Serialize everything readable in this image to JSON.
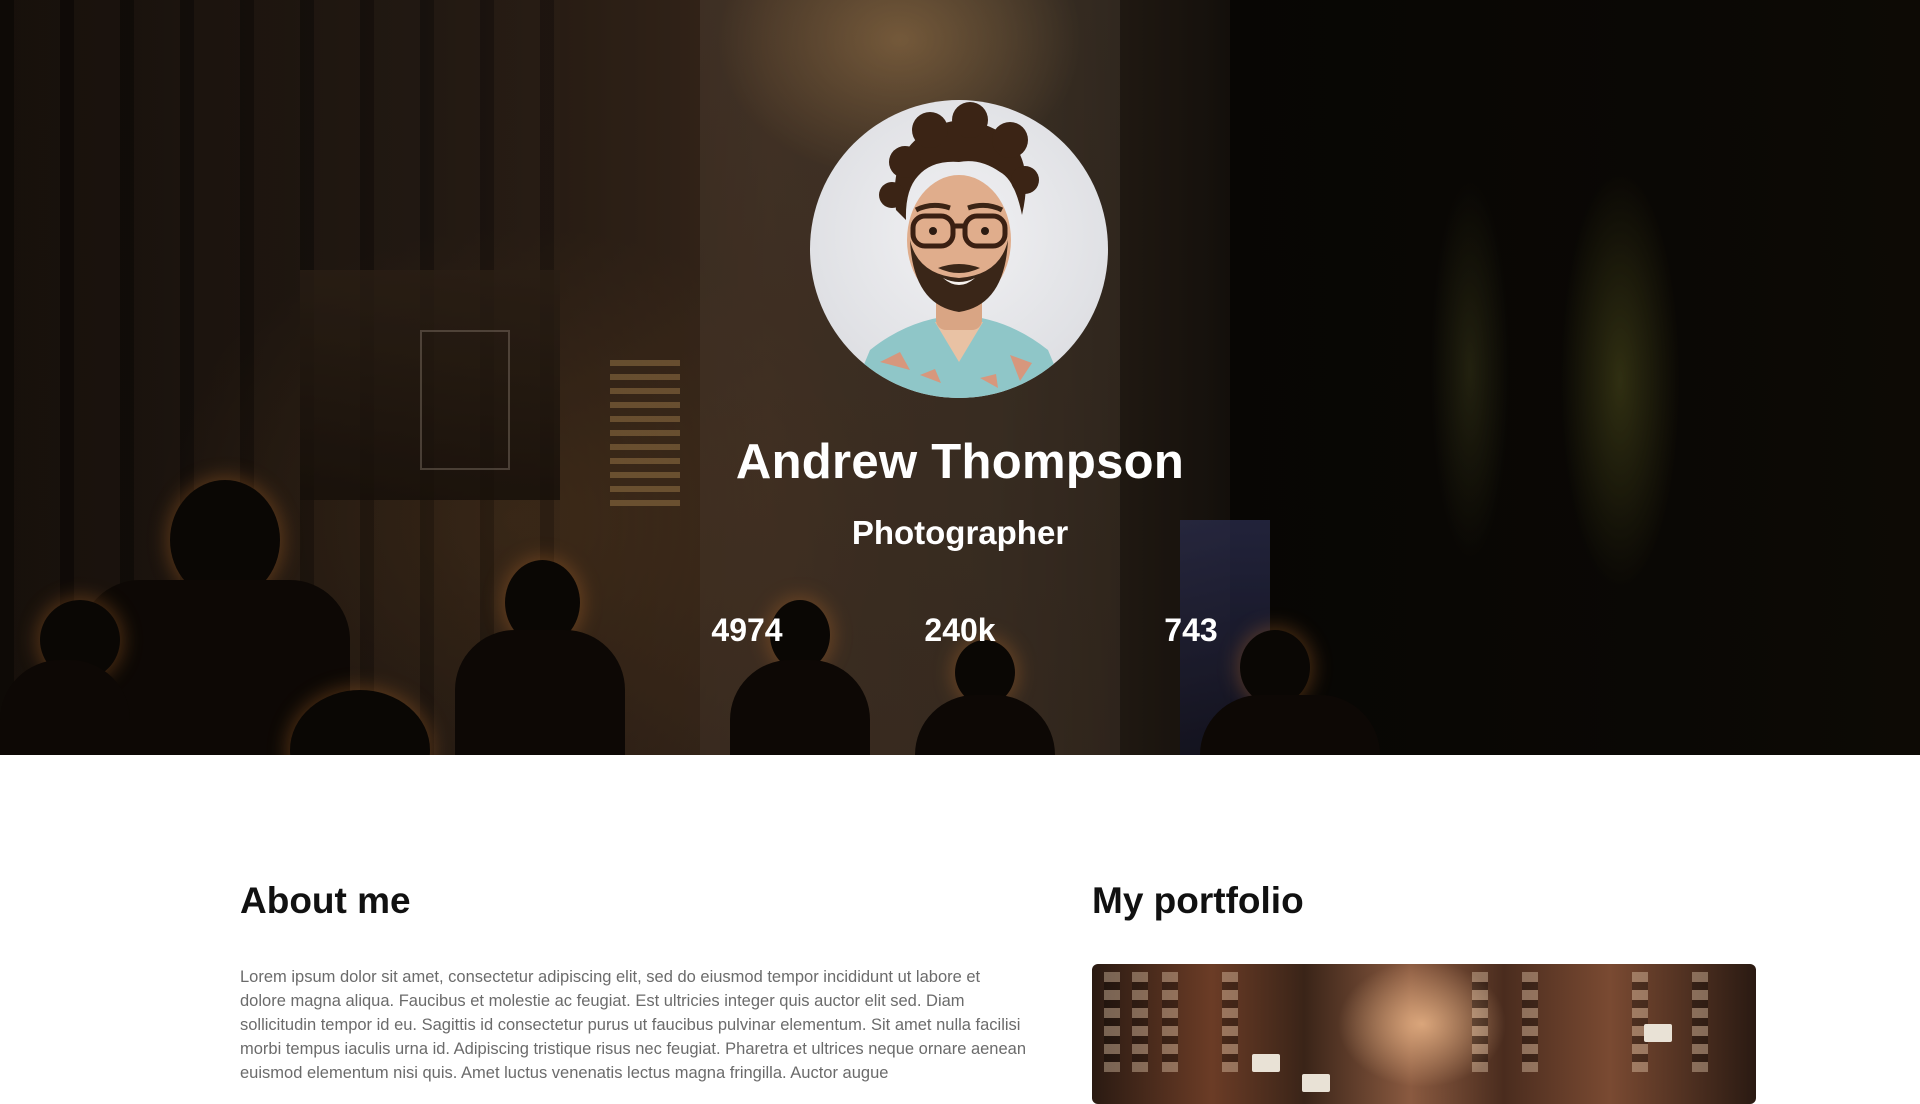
{
  "profile": {
    "name": "Andrew Thompson",
    "role": "Photographer",
    "stats": [
      "4974",
      "240k",
      "743"
    ]
  },
  "about": {
    "title": "About me",
    "text": "Lorem ipsum dolor sit amet, consectetur adipiscing elit, sed do eiusmod tempor incididunt ut labore et dolore magna aliqua. Faucibus et molestie ac feugiat. Est ultricies integer quis auctor elit sed. Diam sollicitudin tempor id eu. Sagittis id consectetur purus ut faucibus pulvinar elementum. Sit amet nulla facilisi morbi tempus iaculis urna id. Adipiscing tristique risus nec feugiat. Pharetra et ultrices neque ornare aenean euismod elementum nisi quis. Amet luctus venenatis lectus magna fringilla. Auctor augue"
  },
  "portfolio": {
    "title": "My portfolio"
  },
  "colors": {
    "heading": "#111111",
    "body_text": "#6b6b6b",
    "hero_text": "#ffffff",
    "page_background": "#ffffff"
  },
  "icons": {
    "hero_background": "city-street-photo",
    "avatar": "profile-photo",
    "portfolio_item": "street-photo"
  }
}
